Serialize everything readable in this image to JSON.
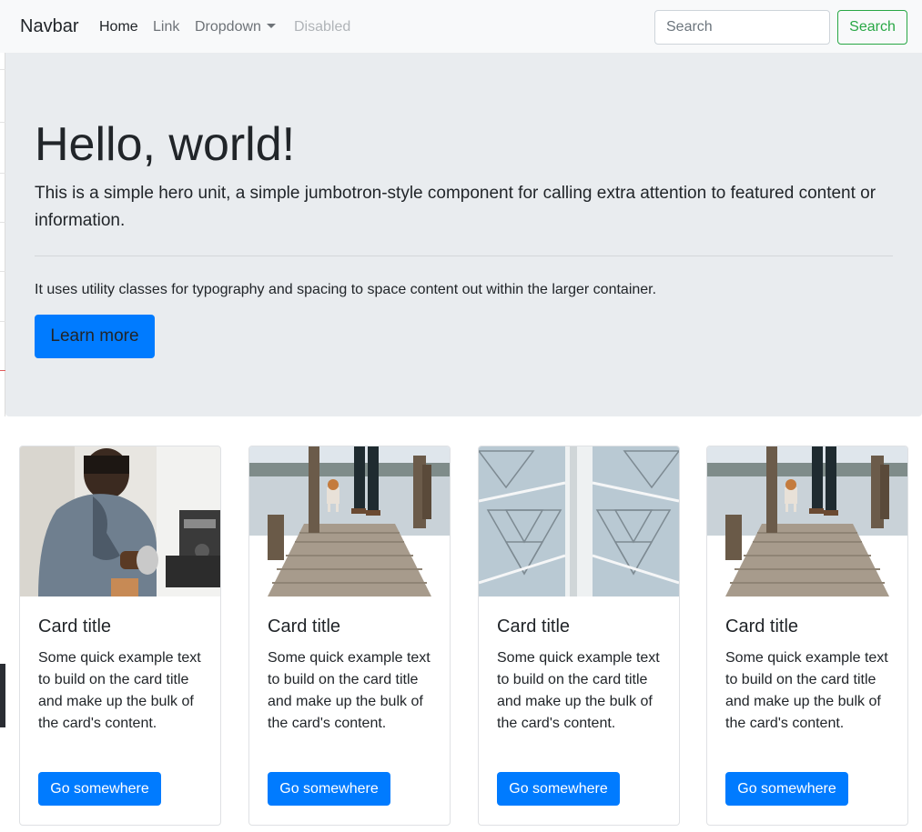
{
  "navbar": {
    "brand": "Navbar",
    "links": [
      {
        "label": "Home",
        "state": "active"
      },
      {
        "label": "Link",
        "state": "normal"
      },
      {
        "label": "Dropdown",
        "state": "dropdown"
      },
      {
        "label": "Disabled",
        "state": "disabled"
      }
    ],
    "search": {
      "placeholder": "Search",
      "button_label": "Search"
    }
  },
  "jumbotron": {
    "heading": "Hello, world!",
    "lead": "This is a simple hero unit, a simple jumbotron-style component for calling extra attention to featured content or information.",
    "text": "It uses utility classes for typography and spacing to space content out within the larger container.",
    "button_label": "Learn more"
  },
  "cards": [
    {
      "image": "barista-photo",
      "title": "Card title",
      "text": "Some quick example text to build on the card title and make up the bulk of the card's content.",
      "button_label": "Go somewhere"
    },
    {
      "image": "dock-dog-photo",
      "title": "Card title",
      "text": "Some quick example text to build on the card title and make up the bulk of the card's content.",
      "button_label": "Go somewhere"
    },
    {
      "image": "fractal-structure-photo",
      "title": "Card title",
      "text": "Some quick example text to build on the card title and make up the bulk of the card's content.",
      "button_label": "Go somewhere"
    },
    {
      "image": "dock-dog-photo",
      "title": "Card title",
      "text": "Some quick example text to build on the card title and make up the bulk of the card's content.",
      "button_label": "Go somewhere"
    }
  ],
  "colors": {
    "primary": "#007bff",
    "success": "#28a745",
    "jumbotron_bg": "#e9ecef",
    "navbar_bg": "#f8f9fa"
  }
}
